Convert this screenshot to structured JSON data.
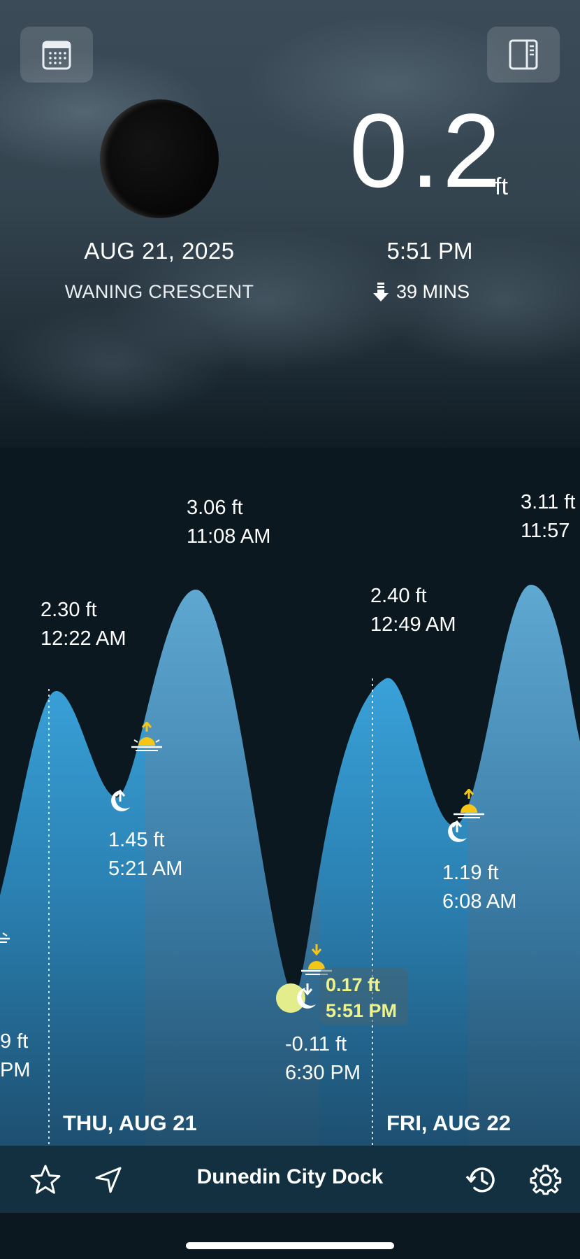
{
  "header": {
    "moon_date": "AUG 21, 2025",
    "moon_phase": "WANING CRESCENT",
    "current_height_value": "0.2",
    "current_height_unit": "ft",
    "current_time": "5:51 PM",
    "countdown": "39 MINS"
  },
  "chart": {
    "extremes": [
      {
        "height": "2.30 ft",
        "time": "12:22 AM"
      },
      {
        "height": "3.06 ft",
        "time": "11:08 AM"
      },
      {
        "height": "1.45 ft",
        "time": "5:21 AM"
      },
      {
        "height": "-0.11 ft",
        "time": "6:30 PM"
      },
      {
        "height": "2.40 ft",
        "time": "12:49 AM"
      },
      {
        "height": "3.11 ft",
        "time": "11:57"
      },
      {
        "height": "1.19 ft",
        "time": "6:08 AM"
      },
      {
        "height": "9 ft",
        "time": "PM"
      }
    ],
    "current": {
      "height": "0.17 ft",
      "time": "5:51 PM"
    },
    "days": [
      "THU, AUG 21",
      "FRI, AUG 22"
    ],
    "colors": {
      "tide_day": "#5aa9d6",
      "tide_night": "#3aaee8",
      "highlight": "#eef28a",
      "sun": "#f5c518"
    }
  },
  "bottom_bar": {
    "station": "Dunedin City Dock",
    "icons": [
      "star-icon",
      "location-arrow-icon",
      "history-icon",
      "gear-icon"
    ]
  }
}
